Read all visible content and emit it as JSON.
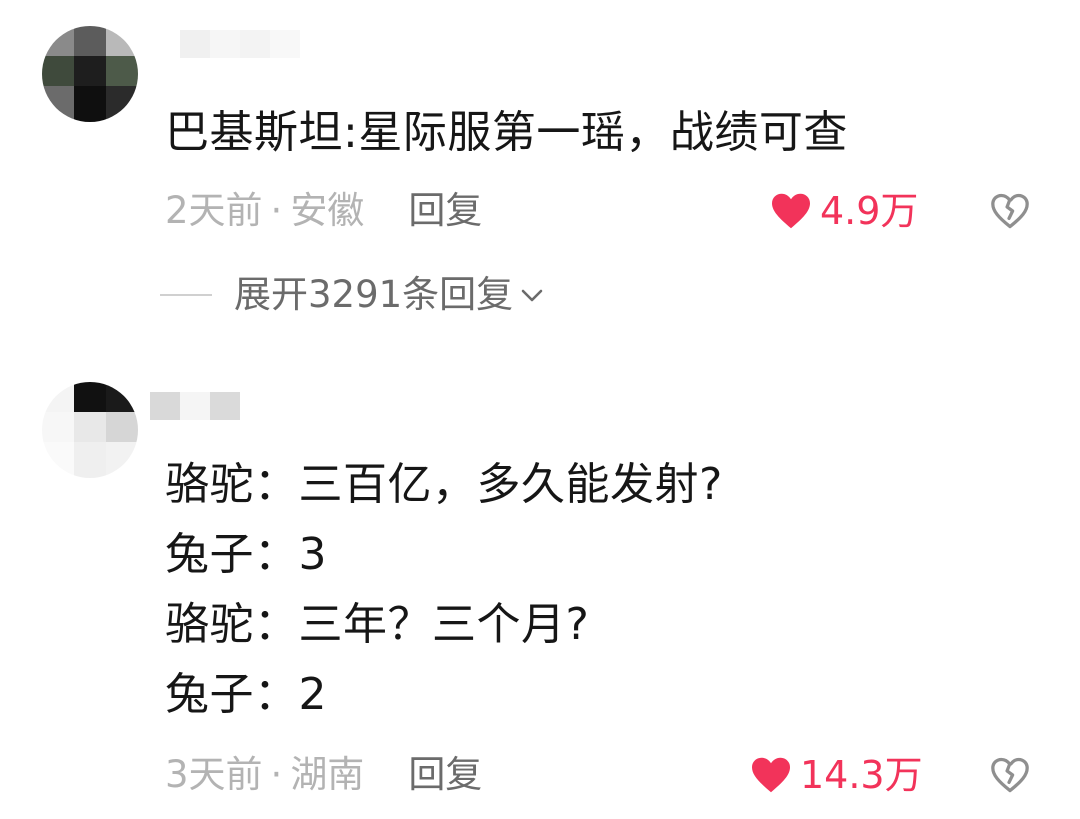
{
  "comments": [
    {
      "content_lines": [
        "巴基斯坦:星际服第一瑶，战绩可查"
      ],
      "time": "2天前",
      "separator": "·",
      "location": "安徽",
      "reply_label": "回复",
      "like_count": "4.9万",
      "expand_replies_label": "展开3291条回复"
    },
    {
      "content_lines": [
        "骆驼：三百亿，多久能发射?",
        "兔子：3",
        "骆驼：三年？三个月?",
        "兔子：2"
      ],
      "time": "3天前",
      "separator": "·",
      "location": "湖南",
      "reply_label": "回复",
      "like_count": "14.3万"
    }
  ],
  "colors": {
    "like": "#f2335a",
    "meta": "#b3b3b3",
    "reply": "#6b6b6b",
    "text": "#161616"
  },
  "icons": [
    "heart-filled-icon",
    "broken-heart-icon",
    "chevron-down-icon"
  ]
}
